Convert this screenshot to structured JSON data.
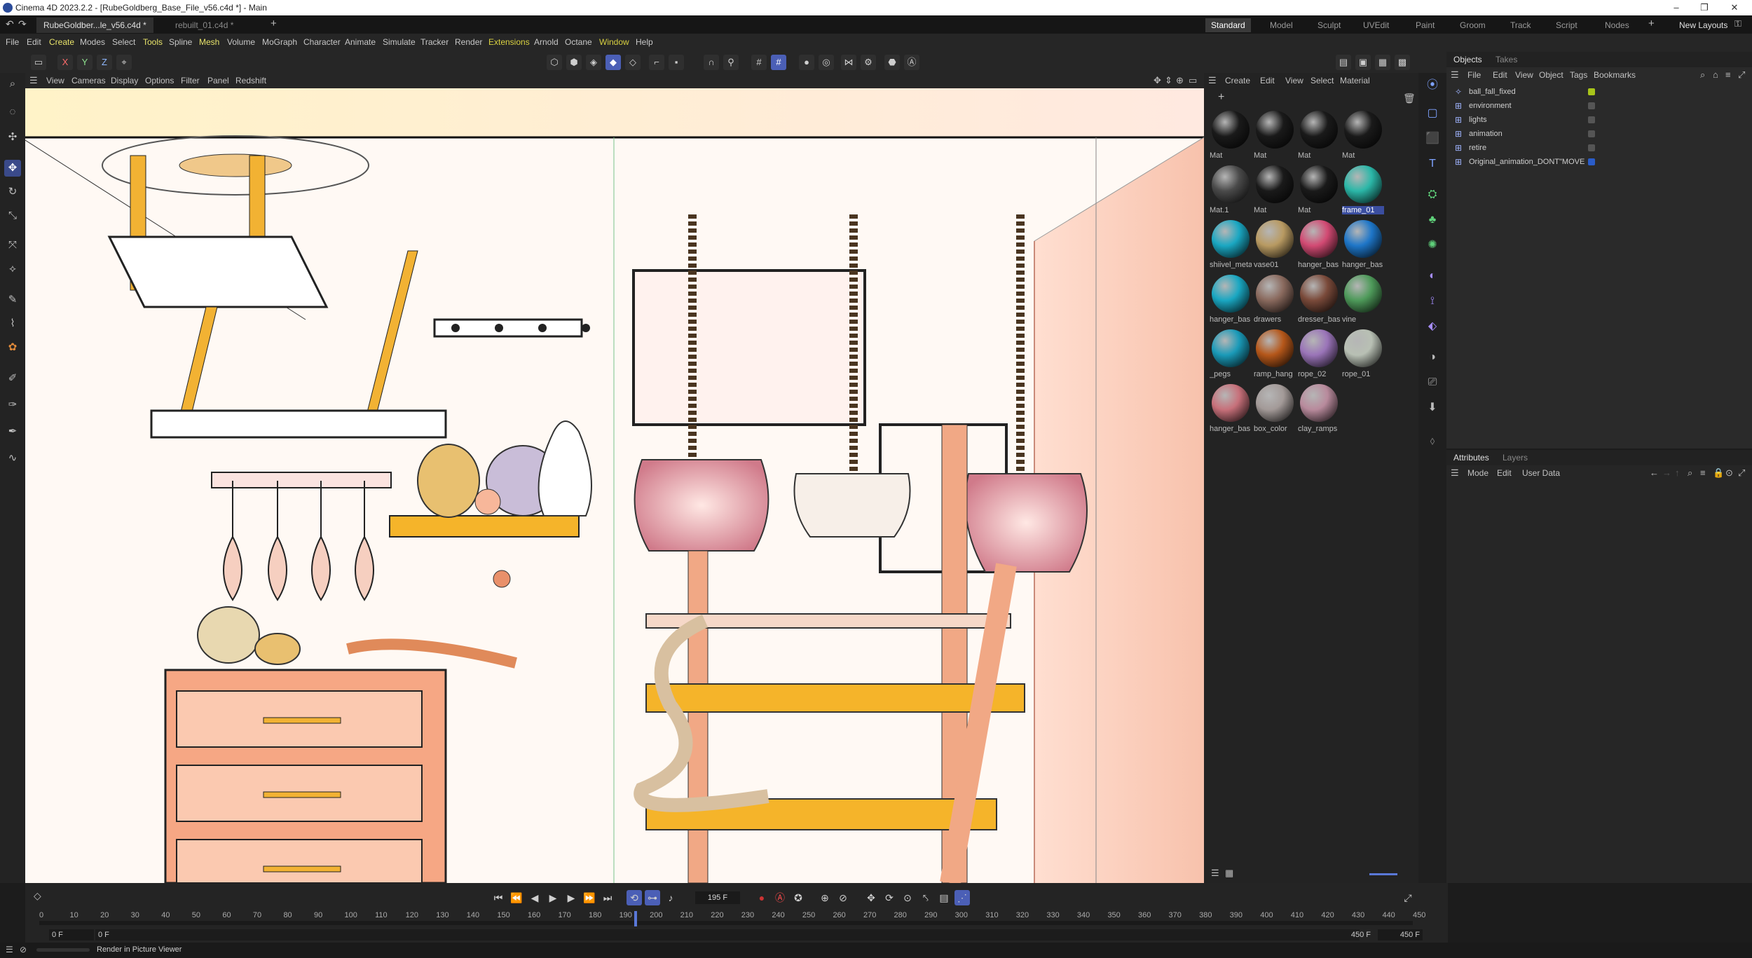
{
  "window": {
    "title": "Cinema 4D 2023.2.2 - [RubeGoldberg_Base_File_v56.c4d *] - Main"
  },
  "doc_tabs": [
    {
      "label": "RubeGoldber...le_v56.c4d *",
      "active": true
    },
    {
      "label": "rebuilt_01.c4d *",
      "active": false
    }
  ],
  "layouts": [
    "Standard",
    "Model",
    "Sculpt",
    "UVEdit",
    "Paint",
    "Groom",
    "Track",
    "Script",
    "Nodes"
  ],
  "new_layouts": "New Layouts",
  "menus": [
    "File",
    "Edit",
    "Create",
    "Modes",
    "Select",
    "Tools",
    "Spline",
    "Mesh",
    "Volume",
    "MoGraph",
    "Character",
    "Animate",
    "Simulate",
    "Tracker",
    "Render",
    "Extensions",
    "Arnold",
    "Octane",
    "Window",
    "Help"
  ],
  "axes": [
    "X",
    "Y",
    "Z"
  ],
  "viewport_menu": [
    "View",
    "Cameras",
    "Display",
    "Options",
    "Filter",
    "Panel",
    "Redshift"
  ],
  "material_menu": [
    "Create",
    "Edit",
    "View",
    "Select",
    "Material"
  ],
  "materials": [
    {
      "name": "Mat",
      "color": "#1a1a1a"
    },
    {
      "name": "Mat",
      "color": "#1a1a1a"
    },
    {
      "name": "Mat",
      "color": "#1a1a1a"
    },
    {
      "name": "Mat",
      "color": "#1a1a1a"
    },
    {
      "name": "Mat.1",
      "color": "#4a4a4a"
    },
    {
      "name": "Mat",
      "color": "#1a1a1a"
    },
    {
      "name": "Mat",
      "color": "#1a1a1a"
    },
    {
      "name": "frame_01",
      "color": "#2bb7a8"
    },
    {
      "name": "shiivel_meta",
      "color": "#1aa7c2"
    },
    {
      "name": "vase01",
      "color": "#b89a62"
    },
    {
      "name": "hanger_bas",
      "color": "#d24a73"
    },
    {
      "name": "hanger_bas",
      "color": "#1e76c8"
    },
    {
      "name": "hanger_bas",
      "color": "#1aa7c2"
    },
    {
      "name": "drawers",
      "color": "#8a6a5e"
    },
    {
      "name": "dresser_bas",
      "color": "#7a4a3a"
    },
    {
      "name": "vine",
      "color": "#4e9a5a"
    },
    {
      "name": "_pegs",
      "color": "#1a9ab8"
    },
    {
      "name": "ramp_hang",
      "color": "#b5571a"
    },
    {
      "name": "rope_02",
      "color": "#9a74b8"
    },
    {
      "name": "rope_01",
      "color": "#b8c0b4"
    },
    {
      "name": "hanger_bas",
      "color": "#c7707a"
    },
    {
      "name": "box_color",
      "color": "#a39a98"
    },
    {
      "name": "clay_ramps",
      "color": "#b88a9c"
    }
  ],
  "objects_tabs": [
    "Objects",
    "Takes"
  ],
  "objects_menu": [
    "File",
    "Edit",
    "View",
    "Object",
    "Tags",
    "Bookmarks"
  ],
  "objects": [
    {
      "name": "ball_fall_fixed",
      "color": "#a8c41a"
    },
    {
      "name": "environment",
      "color": ""
    },
    {
      "name": "lights",
      "color": ""
    },
    {
      "name": "animation",
      "color": ""
    },
    {
      "name": "retire",
      "color": ""
    },
    {
      "name": "Original_animation_DONT\"MOVE",
      "color": "#2a5cc8"
    }
  ],
  "attributes_tabs": [
    "Attributes",
    "Layers"
  ],
  "attributes_menu": [
    "Mode",
    "Edit",
    "User Data"
  ],
  "timeline": {
    "current_frame": "195 F",
    "start_frame": "0 F",
    "start_frame2": "0 F",
    "end_frame": "450 F",
    "end_frame2": "450 F",
    "ticks": [
      "0",
      "10",
      "20",
      "30",
      "40",
      "50",
      "60",
      "70",
      "80",
      "90",
      "100",
      "110",
      "120",
      "130",
      "140",
      "150",
      "160",
      "170",
      "180",
      "190",
      "200",
      "210",
      "220",
      "230",
      "240",
      "250",
      "260",
      "270",
      "280",
      "290",
      "300",
      "310",
      "320",
      "330",
      "340",
      "350",
      "360",
      "370",
      "380",
      "390",
      "400",
      "410",
      "420",
      "430",
      "440",
      "450"
    ],
    "playhead_frame": 195,
    "max_frame": 450
  },
  "status": {
    "text": "Render in Picture Viewer"
  },
  "colors": {
    "accent": "#4b5fb6",
    "extensions_menu": "#d8d040"
  }
}
